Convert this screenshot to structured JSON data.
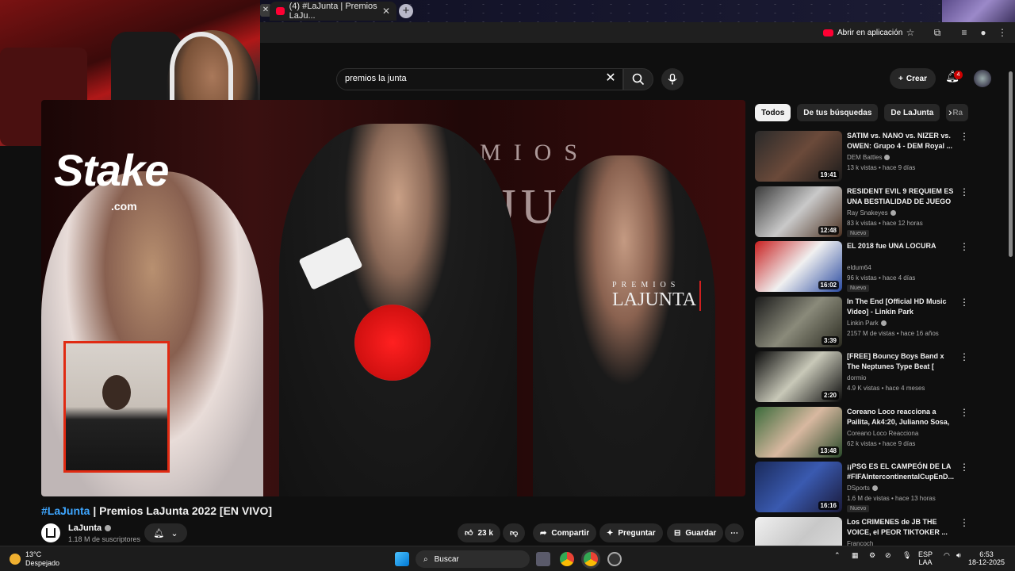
{
  "browser": {
    "tab_title": "(4) #LaJunta | Premios LaJu...",
    "open_in_app_label": "Abrir en aplicación"
  },
  "header": {
    "search_value": "premios la junta",
    "create_label": "Crear",
    "notification_count": "4"
  },
  "video": {
    "overlay": {
      "sponsor": "Stake",
      "sponsor_domain": ".com",
      "banner_top": "PREMIOS",
      "banner_main": "LAJUNTA",
      "logo_small": "PREMIOS",
      "logo_main": "LAJUNTA"
    },
    "title_tag": "#LaJunta",
    "title_rest": " | Premios LaJunta 2022 [EN VIVO]",
    "channel_name": "LaJunta",
    "subscribers": "1.18 M de suscriptores",
    "likes": "23 k",
    "share_label": "Compartir",
    "ask_label": "Preguntar",
    "save_label": "Guardar"
  },
  "sidebar": {
    "chips": [
      "Todos",
      "De tus búsquedas",
      "De LaJunta",
      "Ra"
    ],
    "recommendations": [
      {
        "title": "SATIM vs. NANO vs. NIZER vs. OWEN: Grupo 4 - DEM Royal ...",
        "channel": "DEM Battles",
        "verified": true,
        "meta": "13 k vistas • hace 9 días",
        "duration": "19:41",
        "badge": "",
        "thumb_colors": [
          "#2a2a2a",
          "#6b4a3a",
          "#1a1a1a"
        ]
      },
      {
        "title": "RESIDENT EVIL 9 REQUIEM ES UNA BESTIALIDAD DE JUEGO",
        "channel": "Ray Snakeyes",
        "verified": true,
        "meta": "83 k vistas • hace 12 horas",
        "duration": "12:48",
        "badge": "Nuevo",
        "thumb_colors": [
          "#3a3a3a",
          "#c9c9c9",
          "#4a3020"
        ]
      },
      {
        "title": "EL 2018 fue UNA LOCURA",
        "channel": "eldum64",
        "verified": false,
        "meta": "96 k vistas • hace 4 días",
        "duration": "16:02",
        "badge": "Nuevo",
        "thumb_colors": [
          "#c82020",
          "#f0f0f0",
          "#2a4aa0"
        ]
      },
      {
        "title": "In The End [Official HD Music Video] - Linkin Park",
        "channel": "Linkin Park",
        "verified": true,
        "meta": "2157 M de vistas • hace 16 años",
        "duration": "3:39",
        "badge": "",
        "thumb_colors": [
          "#1a1a1a",
          "#8a8a7a",
          "#2a2a20"
        ]
      },
      {
        "title": "[FREE] Bouncy Boys Band x The Neptunes Type Beat [ dormio ]",
        "channel": "dormio",
        "verified": false,
        "meta": "4.9 K vistas • hace 4 meses",
        "duration": "2:20",
        "badge": "",
        "thumb_colors": [
          "#0a0a0a",
          "#c8c8b8",
          "#0a0a0a"
        ]
      },
      {
        "title": "Coreano Loco reacciona a Pailita, Ak4:20, Julianno Sosa, ...",
        "channel": "Coreano Loco Reacciona",
        "verified": false,
        "meta": "62 k vistas • hace 9 días",
        "duration": "13:48",
        "badge": "",
        "thumb_colors": [
          "#3a6a3a",
          "#d8b8a0",
          "#2a4a2a"
        ]
      },
      {
        "title": "¡¡PSG ES EL CAMPEÓN DE LA #FIFAIntercontinentalCupEnD...",
        "channel": "DSports",
        "verified": true,
        "meta": "1.6 M de vistas • hace 13 horas",
        "duration": "16:16",
        "badge": "Nuevo",
        "thumb_colors": [
          "#1a2a5a",
          "#3a5ab0",
          "#1a1a3a"
        ]
      },
      {
        "title": "Los CRIMENES de JB THE VOICE, el PEOR TIKTOKER ...",
        "channel": "Francoch",
        "verified": false,
        "meta": "",
        "duration": "",
        "badge": "",
        "thumb_colors": [
          "#f0f0f0",
          "#c8c8c8",
          "#e0e0e0"
        ]
      }
    ]
  },
  "taskbar": {
    "temperature": "13°C",
    "weather_desc": "Despejado",
    "search_label": "Buscar",
    "lang_top": "ESP",
    "lang_bottom": "LAA",
    "time": "6:53",
    "date": "18-12-2025"
  },
  "colors": {
    "youtube_red": "#ff0033",
    "link_blue": "#3ea6ff",
    "interpreter_border": "#e02a12"
  }
}
